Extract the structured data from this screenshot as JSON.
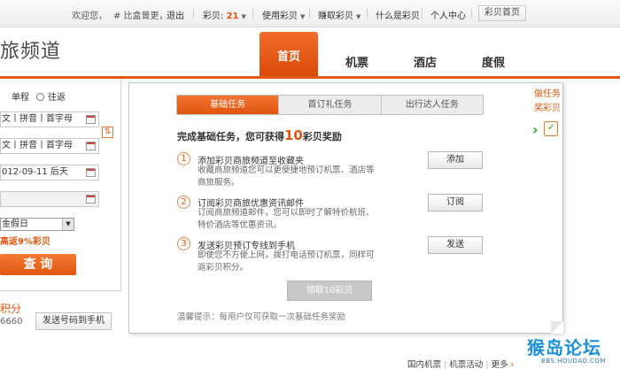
{
  "topbar": {
    "welcome": "欢迎您，",
    "username": "# 比盒曾更，",
    "logout": "退出",
    "points_label": "彩贝:",
    "points_count": "21",
    "use_points": "使用彩贝",
    "earn_points": "赚取彩贝",
    "what_is": "什么是彩贝",
    "personal_center": "个人中心",
    "home_button": "彩贝首页"
  },
  "channel_title": "旅频道",
  "main_tabs": [
    {
      "label": "首页"
    },
    {
      "label": "机票"
    },
    {
      "label": "酒店"
    },
    {
      "label": "度假"
    }
  ],
  "search": {
    "trip_oneway": "单程",
    "trip_round": "往返",
    "from_placeholder": "文丨拼音丨首字母",
    "to_placeholder": "文丨拼音丨首字母",
    "date_value": "012-09-11 后天",
    "date2_value": "",
    "airline_select": "金假日",
    "promo": "高返9%彩贝",
    "search_button": "查 询"
  },
  "points_panel": {
    "title": "积分",
    "number": "6660",
    "sms_button": "发送号码到手机"
  },
  "dialog": {
    "tabs": [
      {
        "label": "基础任务"
      },
      {
        "label": "首订礼任务"
      },
      {
        "label": "出行达人任务"
      }
    ],
    "heading_pre": "完成基础任务，您可获得",
    "heading_num": "10",
    "heading_post": "彩贝奖励",
    "tasks": [
      {
        "num": "1",
        "title": "添加彩贝商旅频道至收藏夹",
        "desc": "收藏商旅频道您可以更便捷地预订机票、酒店等商旅服务。",
        "button": "添加"
      },
      {
        "num": "2",
        "title": "订阅彩贝商旅优惠资讯邮件",
        "desc": "订阅商旅频道邮件，您可以即时了解特价航班、特价酒店等优惠资讯。",
        "button": "订阅"
      },
      {
        "num": "3",
        "title": "发送彩贝预订专线到手机",
        "desc": "即使您不方便上网，拨打电话预订机票，同样可返彩贝积分。",
        "button": "发送"
      }
    ],
    "claim_button": "领取10彩贝",
    "tip": "温馨提示：每用户仅可获取一次基础任务奖励"
  },
  "side": {
    "do_task": "做任务",
    "earn_points": "奖彩贝"
  },
  "bottom_links": {
    "intl_flights": "国内机票",
    "flight_events": "机票活动",
    "more": "更多"
  },
  "watermark": {
    "text": "猴岛论坛",
    "sub": "BBS.HOUDAO.COM"
  },
  "colors": {
    "accent": "#e0550e",
    "link_blue": "#1b8fd8"
  }
}
